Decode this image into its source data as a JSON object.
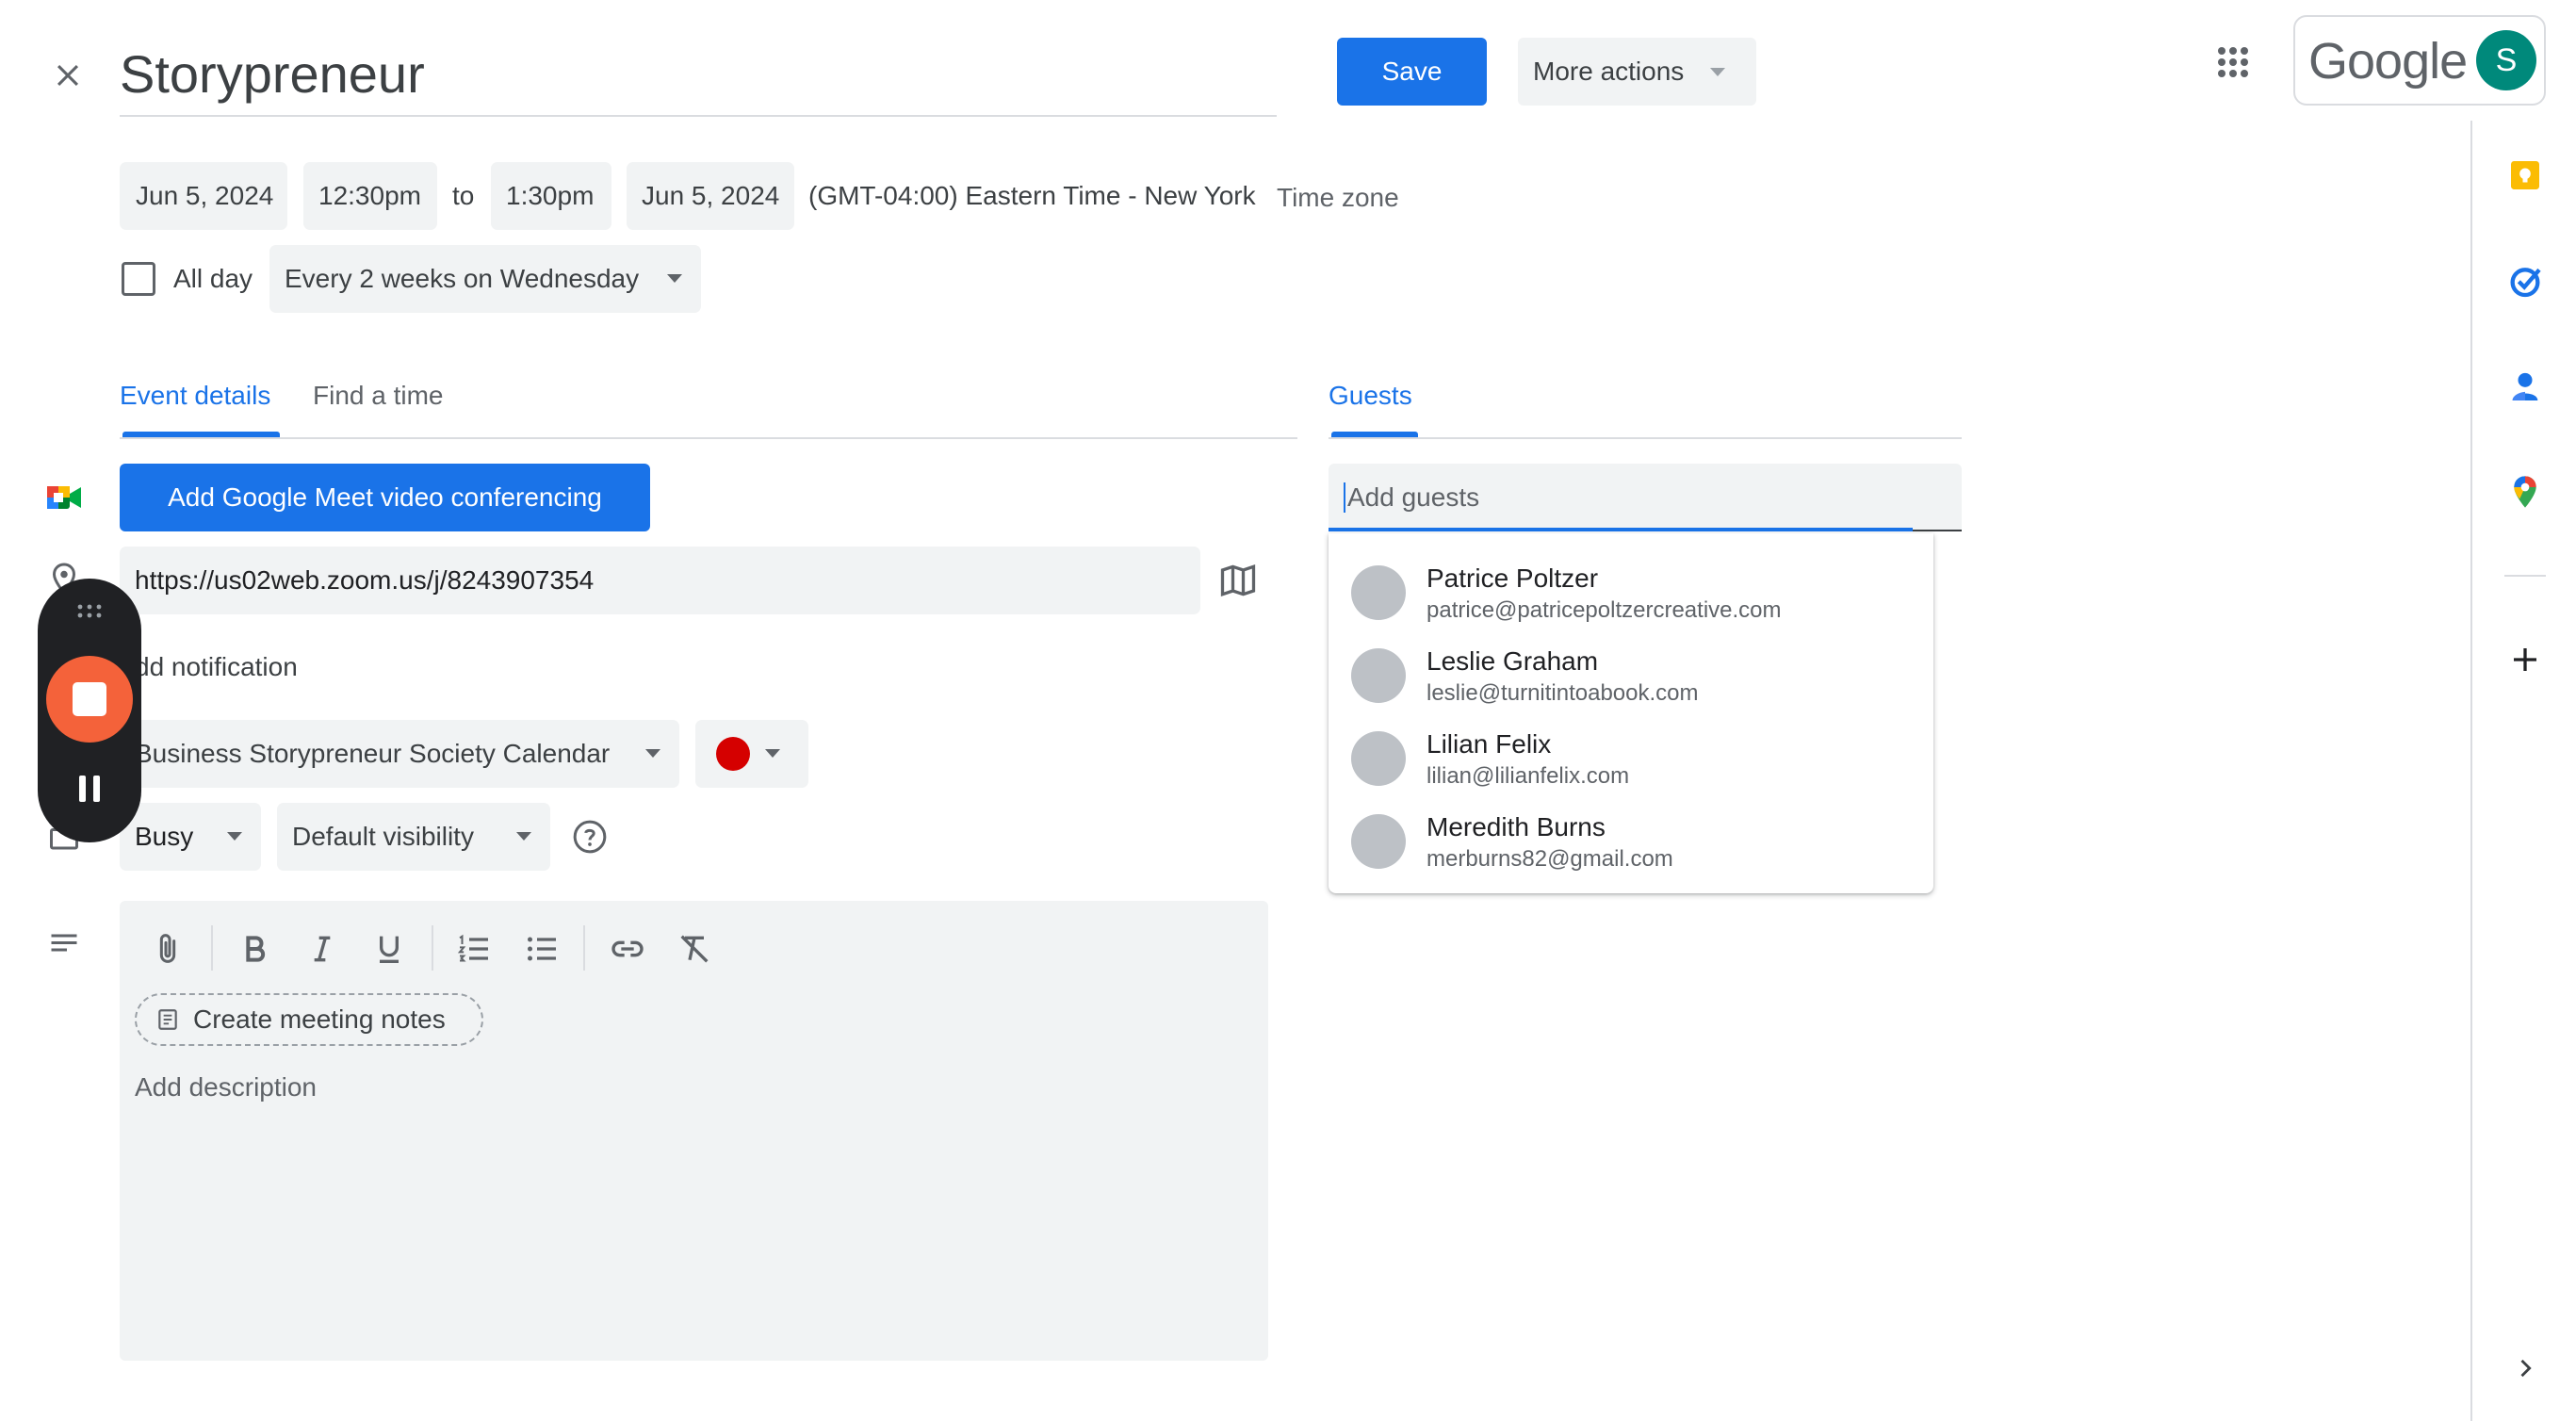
{
  "header": {
    "title": "Storypreneur",
    "save_label": "Save",
    "more_actions_label": "More actions",
    "brand": "Google",
    "avatar_initial": "S"
  },
  "datetime": {
    "start_date": "Jun 5, 2024",
    "start_time": "12:30pm",
    "to_label": "to",
    "end_time": "1:30pm",
    "end_date": "Jun 5, 2024",
    "timezone_text": "(GMT-04:00) Eastern Time - New York",
    "timezone_link": "Time zone",
    "all_day_label": "All day",
    "all_day_checked": false,
    "recurrence": "Every 2 weeks on Wednesday"
  },
  "tabs": [
    {
      "label": "Event details",
      "active": true
    },
    {
      "label": "Find a time",
      "active": false
    }
  ],
  "details": {
    "meet_button": "Add Google Meet video conferencing",
    "location": "https://us02web.zoom.us/j/8243907354",
    "notification_link": "dd notification",
    "calendar": "Business Storypreneur Society Calendar",
    "event_color": "#d50000",
    "availability": "Busy",
    "visibility": "Default visibility",
    "create_notes": "Create meeting notes",
    "description_placeholder": "Add description"
  },
  "guests": {
    "tab_label": "Guests",
    "input_placeholder": "Add guests",
    "suggestions": [
      {
        "name": "Patrice Poltzer",
        "email": "patrice@patricepoltzercreative.com"
      },
      {
        "name": "Leslie Graham",
        "email": "leslie@turnitintoabook.com"
      },
      {
        "name": "Lilian Felix",
        "email": "lilian@lilianfelix.com"
      },
      {
        "name": "Meredith Burns",
        "email": "merburns82@gmail.com"
      }
    ]
  },
  "colors": {
    "accent": "#1a73e8",
    "recorder_stop": "#f4623a",
    "recorder_bg": "#202124",
    "avatar_bg": "#00897b"
  },
  "side_panel": [
    "keep-icon",
    "tasks-icon",
    "contacts-icon",
    "maps-icon",
    "add-icon",
    "chevron-right-icon"
  ]
}
